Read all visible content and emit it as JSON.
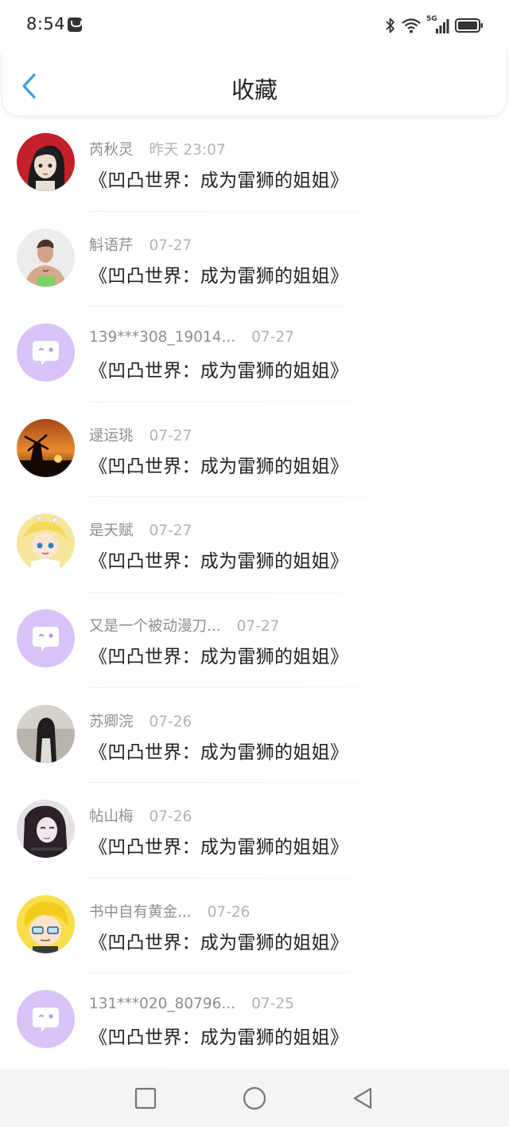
{
  "status_bar": {
    "time": "8:54",
    "network": "5G"
  },
  "header": {
    "title": "收藏"
  },
  "items": [
    {
      "name": "芮秋灵",
      "time": "昨天 23:07",
      "book": "《凹凸世界：成为雷狮的姐姐》",
      "avatar": "photo-avatar"
    },
    {
      "name": "斛语芹",
      "time": "07-27",
      "book": "《凹凸世界：成为雷狮的姐姐》",
      "avatar": "photo-avatar"
    },
    {
      "name": "139***308_19014...",
      "time": "07-27",
      "book": "《凹凸世界：成为雷狮的姐姐》",
      "avatar": "default-avatar"
    },
    {
      "name": "逯运珧",
      "time": "07-27",
      "book": "《凹凸世界：成为雷狮的姐姐》",
      "avatar": "photo-avatar"
    },
    {
      "name": "是天赋",
      "time": "07-27",
      "book": "《凹凸世界：成为雷狮的姐姐》",
      "avatar": "photo-avatar"
    },
    {
      "name": "又是一个被动漫刀...",
      "time": "07-27",
      "book": "《凹凸世界：成为雷狮的姐姐》",
      "avatar": "default-avatar"
    },
    {
      "name": "苏卿浣",
      "time": "07-26",
      "book": "《凹凸世界：成为雷狮的姐姐》",
      "avatar": "photo-avatar"
    },
    {
      "name": "帖山梅",
      "time": "07-26",
      "book": "《凹凸世界：成为雷狮的姐姐》",
      "avatar": "photo-avatar"
    },
    {
      "name": "书中自有黄金...",
      "time": "07-26",
      "book": "《凹凸世界：成为雷狮的姐姐》",
      "avatar": "photo-avatar"
    },
    {
      "name": "131***020_80796...",
      "time": "07-25",
      "book": "《凹凸世界：成为雷狮的姐姐》",
      "avatar": "default-avatar"
    }
  ],
  "colors": {
    "accent": "#3a9ee8",
    "default_avatar_bg": "#d9c2f5"
  },
  "navbar": {
    "icons": [
      "square-icon",
      "circle-icon",
      "triangle-back-icon"
    ]
  }
}
